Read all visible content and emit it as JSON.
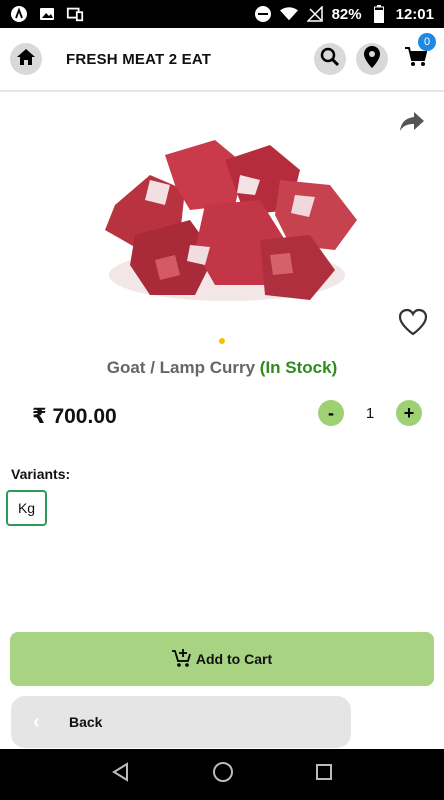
{
  "status_bar": {
    "battery_pct": "82%",
    "time": "12:01"
  },
  "header": {
    "title": "FRESH MEAT 2 EAT",
    "cart_count": "0"
  },
  "product": {
    "name": "Goat / Lamp Curry",
    "stock": "(In Stock)",
    "price": "₹ 700.00",
    "quantity": "1",
    "qty_minus": "-",
    "qty_plus": "+"
  },
  "variants": {
    "label": "Variants:",
    "options": [
      "Kg"
    ]
  },
  "actions": {
    "add_to_cart": "Add to Cart",
    "back": "Back"
  },
  "colors": {
    "accent_green": "#a8d382",
    "stock_green": "#2e8b1c",
    "badge_blue": "#1e88e5",
    "variant_border": "#2e9a5a"
  },
  "icons": [
    "home-icon",
    "search-icon",
    "location-icon",
    "cart-icon",
    "share-icon",
    "heart-icon",
    "add-cart-icon",
    "chevron-left-icon"
  ]
}
